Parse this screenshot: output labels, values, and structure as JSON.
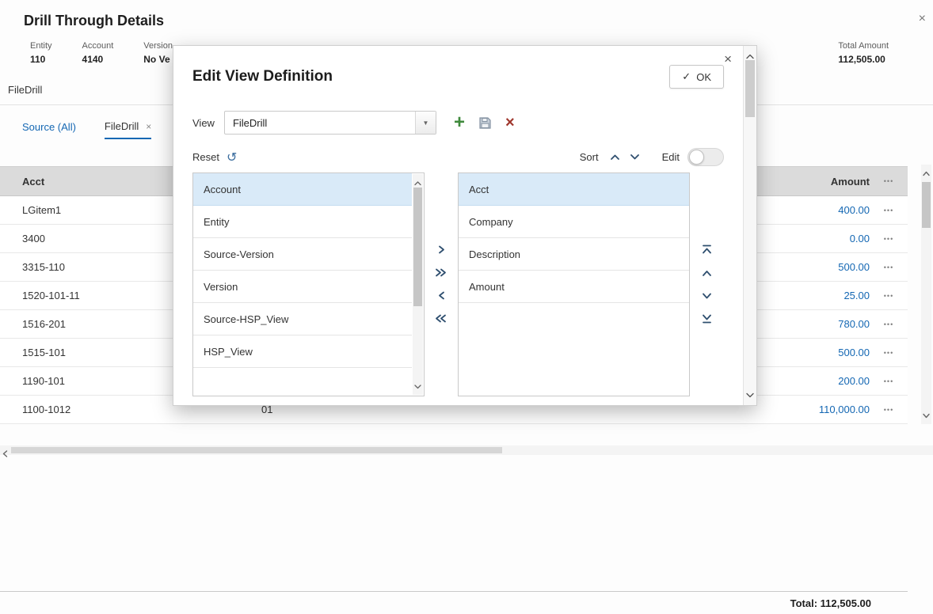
{
  "colors": {
    "link_blue": "#1467b3",
    "selection_blue": "#d9eaf8",
    "plus_green": "#3f8a3c",
    "delete_red": "#a0382e",
    "table_header_gray": "#dbdbdb"
  },
  "icons": {
    "close": "×",
    "check": "✓",
    "menu": "•••",
    "dropdown": "▼",
    "plus": "+",
    "delete": "×",
    "undo": "↺"
  },
  "page": {
    "title": "Drill Through Details",
    "pov": [
      {
        "label": "Entity",
        "value": "110"
      },
      {
        "label": "Account",
        "value": "4140"
      },
      {
        "label": "Version",
        "value": "No Ve"
      }
    ],
    "total_amount": {
      "label": "Total Amount",
      "value": "112,505.00"
    },
    "drill_name": "FileDrill",
    "tabs": [
      {
        "label": "Source (All)",
        "active": false,
        "closable": false
      },
      {
        "label": "FileDrill",
        "active": true,
        "closable": true
      }
    ],
    "table": {
      "acct_header": "Acct",
      "amount_header": "Amount",
      "rows": [
        {
          "acct": "LGitem1",
          "amount": "400.00"
        },
        {
          "acct": "3400",
          "amount": "0.00"
        },
        {
          "acct": "3315-110",
          "amount": "500.00"
        },
        {
          "acct": "1520-101-11",
          "amount": "25.00"
        },
        {
          "acct": "1516-201",
          "amount": "780.00"
        },
        {
          "acct": "1515-101",
          "amount": "500.00"
        },
        {
          "acct": "1190-101",
          "amount": "200.00"
        },
        {
          "acct": "1100-1012",
          "col2": "01",
          "amount": "110,000.00"
        }
      ],
      "total": "Total: 112,505.00"
    }
  },
  "dialog": {
    "title": "Edit View Definition",
    "ok_label": "OK",
    "view_label": "View",
    "view_value": "FileDrill",
    "reset_label": "Reset",
    "sort_label": "Sort",
    "edit_label": "Edit",
    "available_items": [
      {
        "label": "Account",
        "selected": true
      },
      {
        "label": "Entity",
        "selected": false
      },
      {
        "label": "Source-Version",
        "selected": false
      },
      {
        "label": "Version",
        "selected": false
      },
      {
        "label": "Source-HSP_View",
        "selected": false
      },
      {
        "label": "HSP_View",
        "selected": false
      }
    ],
    "selected_columns": [
      {
        "label": "Acct",
        "selected": true
      },
      {
        "label": "Company",
        "selected": false
      },
      {
        "label": "Description",
        "selected": false
      },
      {
        "label": "Amount",
        "selected": false
      }
    ]
  }
}
